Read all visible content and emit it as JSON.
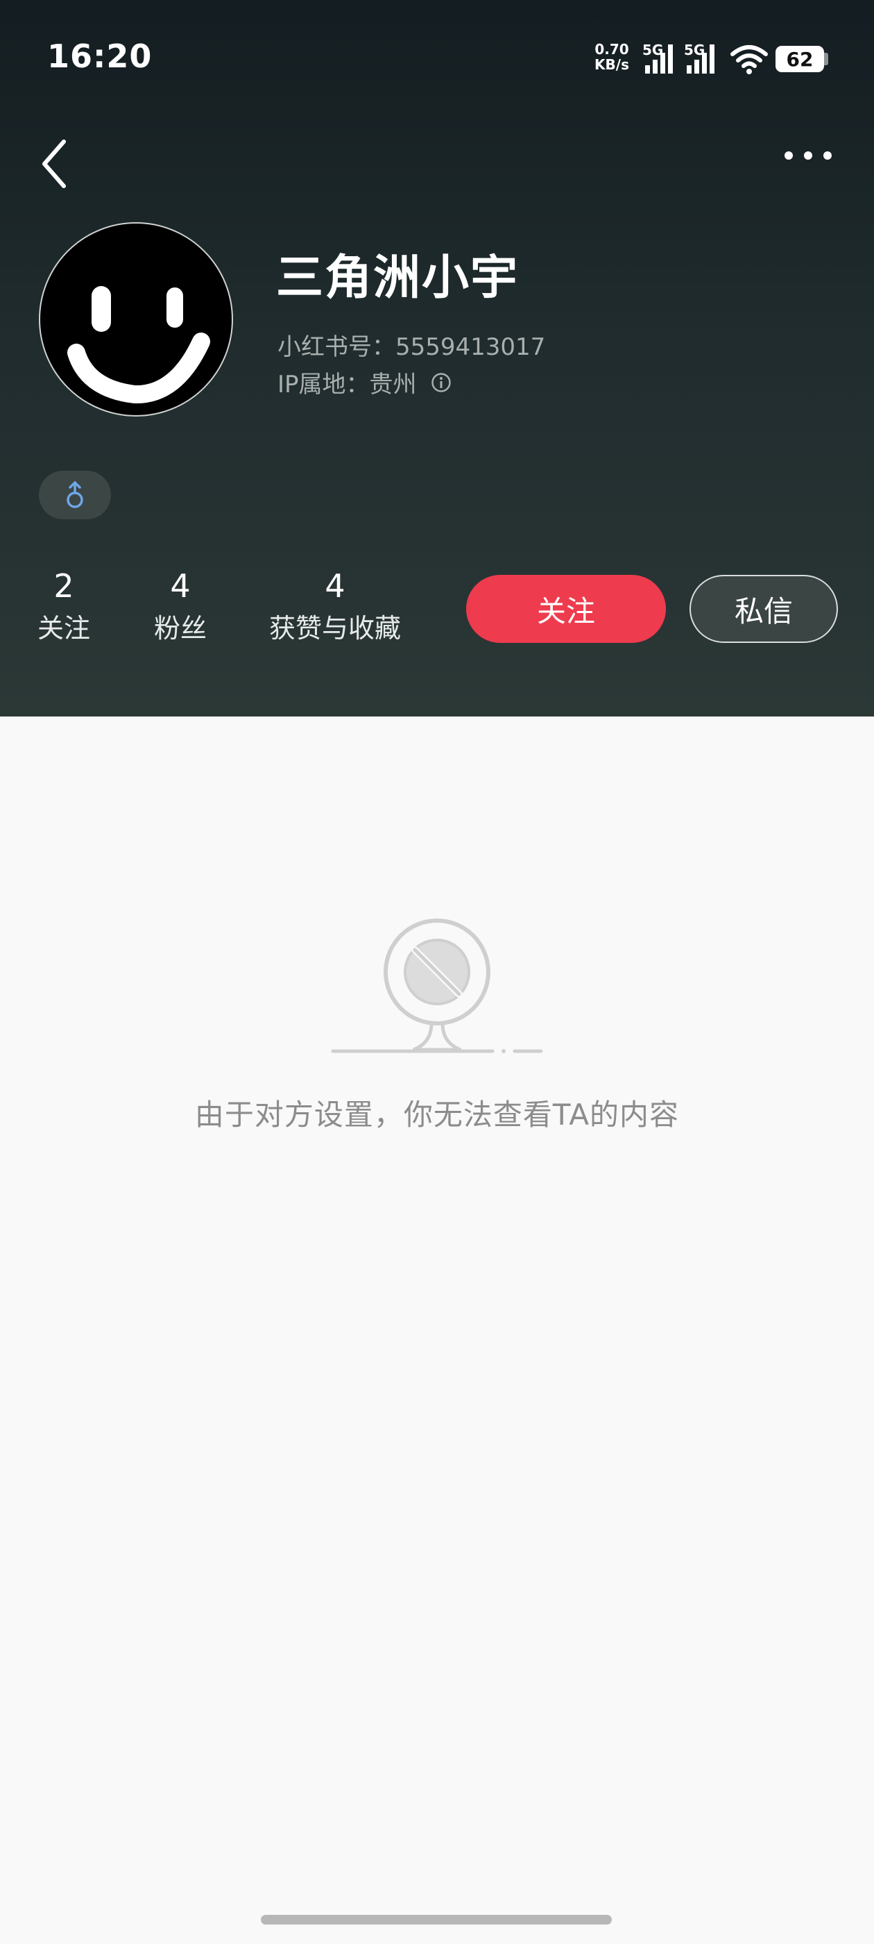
{
  "status_bar": {
    "time": "16:20",
    "net_speed_value": "0.70",
    "net_speed_unit": "KB/s",
    "signal1_label": "5G",
    "signal2_label": "5G",
    "battery_level": "62"
  },
  "profile": {
    "nickname": "三角洲小宇",
    "red_id": "小红书号：5559413017",
    "ip_location": "IP属地：贵州",
    "gender_icon": "male-icon"
  },
  "stats": [
    {
      "value": "2",
      "label": "关注"
    },
    {
      "value": "4",
      "label": "粉丝"
    },
    {
      "value": "4",
      "label": "获赞与收藏"
    }
  ],
  "actions": {
    "follow_label": "关注",
    "message_label": "私信"
  },
  "empty_state": {
    "message": "由于对方设置，你无法查看TA的内容",
    "icon": "blocked-icon"
  },
  "colors": {
    "accent": "#ee3b4e",
    "header_top": "#141d21",
    "header_bottom": "#2c3836",
    "background": "#f9f9f9"
  }
}
